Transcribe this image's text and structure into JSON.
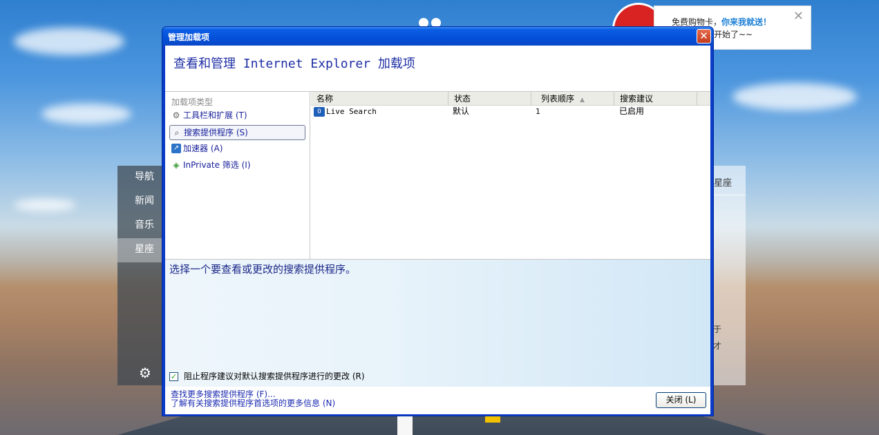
{
  "dialog": {
    "title": "管理加载项",
    "close_glyph": "✕",
    "heading": "查看和管理 Internet Explorer 加载项"
  },
  "addon_types": {
    "label": "加载项类型",
    "items": [
      {
        "label": "工具栏和扩展 (T)",
        "icon": "gear-icon",
        "selected": false
      },
      {
        "label": "搜索提供程序 (S)",
        "icon": "search-icon",
        "selected": true
      },
      {
        "label": "加速器 (A)",
        "icon": "accelerator-icon",
        "selected": false
      },
      {
        "label": "InPrivate 筛选 (I)",
        "icon": "inprivate-icon",
        "selected": false
      }
    ]
  },
  "table": {
    "columns": [
      "名称",
      "状态",
      "列表顺序",
      "搜索建议"
    ],
    "sort_indicator": "▲",
    "rows": [
      {
        "name": "Live Search",
        "status": "默认",
        "order": "1",
        "suggestions": "已启用"
      }
    ]
  },
  "details": {
    "prompt": "选择一个要查看或更改的搜索提供程序。",
    "checkbox_label": "阻止程序建议对默认搜索提供程序进行的更改 (R)",
    "checkbox_checked": true,
    "checkmark": "✓"
  },
  "footer": {
    "link1": "查找更多搜索提供程序 (F)...",
    "link2": "了解有关搜索提供程序首选项的更多信息 (N)",
    "close_button": "关闭 (L)"
  },
  "side_nav": {
    "items": [
      "导航",
      "新闻",
      "音乐",
      "星座"
    ],
    "active_index": 3,
    "settings_glyph": "⚙"
  },
  "right_panel": {
    "label": "星座",
    "char1": "于",
    "char2": "才"
  },
  "promo": {
    "text_prefix": "免费购物卡，",
    "text_highlight": "你来我就送！",
    "text_line2": "开始了~~",
    "close_glyph": "✕"
  },
  "colors": {
    "title_bar": "#0450d8",
    "heading_text": "#1e2fa5",
    "link": "#1a2ab0",
    "promo_highlight": "#1a7fd6"
  }
}
